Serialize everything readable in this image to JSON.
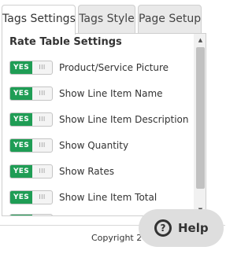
{
  "tabs": [
    {
      "label": "Tags Settings",
      "active": true
    },
    {
      "label": "Tags Style",
      "active": false
    },
    {
      "label": "Page Setup",
      "active": false
    }
  ],
  "panel": {
    "title": "Rate Table Settings",
    "rows": [
      {
        "toggle": "YES",
        "label": "Product/Service Picture"
      },
      {
        "toggle": "YES",
        "label": "Show Line Item Name"
      },
      {
        "toggle": "YES",
        "label": "Show Line Item Description"
      },
      {
        "toggle": "YES",
        "label": "Show Quantity"
      },
      {
        "toggle": "YES",
        "label": "Show Rates"
      },
      {
        "toggle": "YES",
        "label": "Show Line Item Total"
      }
    ],
    "toggle_grip": "III",
    "scroll_up_glyph": "▲",
    "scroll_down_glyph": "▼"
  },
  "footer": {
    "copyright": "Copyright 20"
  },
  "help": {
    "icon_glyph": "?",
    "label": "Help"
  },
  "colors": {
    "toggle_on": "#1f9d55",
    "help_bg": "#dedede"
  }
}
